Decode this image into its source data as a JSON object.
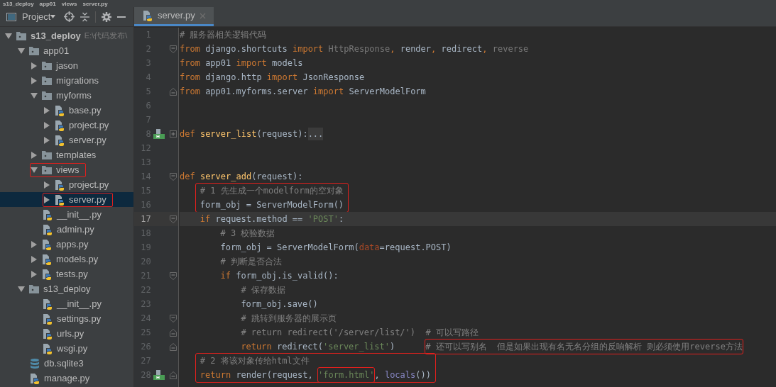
{
  "breadcrumb": [
    "s13_deploy",
    "app01",
    "views",
    "server.py"
  ],
  "project_toolbar": {
    "label": "Project"
  },
  "tree": [
    {
      "label": "s13_deploy",
      "kind": "module",
      "path": "E:\\代码发布\\",
      "expanded": true,
      "selected": false,
      "boxed": false,
      "children": [
        {
          "label": "app01",
          "kind": "module",
          "expanded": true,
          "selected": false,
          "boxed": false,
          "children": [
            {
              "label": "jason",
              "kind": "module",
              "expanded": false,
              "selected": false,
              "boxed": false
            },
            {
              "label": "migrations",
              "kind": "module",
              "expanded": false,
              "selected": false,
              "boxed": false
            },
            {
              "label": "myforms",
              "kind": "module",
              "expanded": true,
              "selected": false,
              "boxed": false,
              "children": [
                {
                  "label": "base.py",
                  "kind": "python",
                  "expanded": false,
                  "selected": false,
                  "boxed": false
                },
                {
                  "label": "project.py",
                  "kind": "python",
                  "expanded": false,
                  "selected": false,
                  "boxed": false
                },
                {
                  "label": "server.py",
                  "kind": "python",
                  "expanded": false,
                  "selected": false,
                  "boxed": false
                }
              ]
            },
            {
              "label": "templates",
              "kind": "module",
              "expanded": false,
              "selected": false,
              "boxed": false
            },
            {
              "label": "views",
              "kind": "module",
              "expanded": true,
              "selected": false,
              "boxed": true,
              "children": [
                {
                  "label": "project.py",
                  "kind": "python",
                  "expanded": false,
                  "selected": false,
                  "boxed": false
                },
                {
                  "label": "server.py",
                  "kind": "python",
                  "expanded": false,
                  "selected": true,
                  "boxed": true
                }
              ]
            },
            {
              "label": "__init__.py",
              "kind": "python",
              "selected": false,
              "boxed": false
            },
            {
              "label": "admin.py",
              "kind": "python",
              "selected": false,
              "boxed": false
            },
            {
              "label": "apps.py",
              "kind": "python",
              "expanded": false,
              "selected": false,
              "boxed": false
            },
            {
              "label": "models.py",
              "kind": "python",
              "expanded": false,
              "selected": false,
              "boxed": false
            },
            {
              "label": "tests.py",
              "kind": "python",
              "expanded": false,
              "selected": false,
              "boxed": false
            }
          ]
        },
        {
          "label": "s13_deploy",
          "kind": "module",
          "expanded": true,
          "selected": false,
          "boxed": false,
          "children": [
            {
              "label": "__init__.py",
              "kind": "python",
              "selected": false,
              "boxed": false
            },
            {
              "label": "settings.py",
              "kind": "python",
              "selected": false,
              "boxed": false
            },
            {
              "label": "urls.py",
              "kind": "python",
              "selected": false,
              "boxed": false
            },
            {
              "label": "wsgi.py",
              "kind": "python",
              "selected": false,
              "boxed": false
            }
          ]
        },
        {
          "label": "db.sqlite3",
          "kind": "database",
          "selected": false,
          "boxed": false
        },
        {
          "label": "manage.py",
          "kind": "python",
          "selected": false,
          "boxed": false
        }
      ]
    }
  ],
  "tabs": [
    {
      "label": "server.py",
      "selected": true
    }
  ],
  "code": [
    {
      "n": "1",
      "current": false,
      "boxed": false,
      "tokens": [
        {
          "t": "# 服务器相关逻辑代码",
          "kind": "comment"
        }
      ]
    },
    {
      "n": "2",
      "current": false,
      "boxed": false,
      "fold": {
        "kind": "start"
      },
      "tokens": [
        {
          "t": "from",
          "kind": "kw"
        },
        {
          "t": " django.shortcuts ",
          "kind": "plain"
        },
        {
          "t": "import ",
          "kind": "kw"
        },
        {
          "t": "HttpResponse",
          "kind": "unused"
        },
        {
          "t": ", ",
          "kind": "kw"
        },
        {
          "t": "render",
          "kind": "plain"
        },
        {
          "t": ", ",
          "kind": "kw"
        },
        {
          "t": "redirect",
          "kind": "plain"
        },
        {
          "t": ", ",
          "kind": "kw"
        },
        {
          "t": "reverse",
          "kind": "unused"
        }
      ]
    },
    {
      "n": "3",
      "current": false,
      "boxed": false,
      "tokens": [
        {
          "t": "from",
          "kind": "kw"
        },
        {
          "t": " app01 ",
          "kind": "plain"
        },
        {
          "t": "import",
          "kind": "kw"
        },
        {
          "t": " models",
          "kind": "plain"
        }
      ]
    },
    {
      "n": "4",
      "current": false,
      "boxed": false,
      "tokens": [
        {
          "t": "from",
          "kind": "kw"
        },
        {
          "t": " django.http ",
          "kind": "plain"
        },
        {
          "t": "import",
          "kind": "kw"
        },
        {
          "t": " JsonResponse",
          "kind": "plain"
        }
      ]
    },
    {
      "n": "5",
      "current": false,
      "boxed": false,
      "fold": {
        "kind": "end"
      },
      "tokens": [
        {
          "t": "from",
          "kind": "kw"
        },
        {
          "t": " app01.myforms.server ",
          "kind": "plain"
        },
        {
          "t": "import",
          "kind": "kw"
        },
        {
          "t": " ServerModelForm",
          "kind": "plain"
        }
      ]
    },
    {
      "n": "6",
      "current": false,
      "boxed": false
    },
    {
      "n": "7",
      "current": false,
      "boxed": false
    },
    {
      "n": "8",
      "current": false,
      "boxed": false,
      "fold": {
        "kind": "collapsed"
      },
      "marker": {
        "kind": "bookmark"
      },
      "tokens": [
        {
          "t": "def",
          "kind": "kw"
        },
        {
          "t": " server_list",
          "kind": "fn"
        },
        {
          "t": "(request):",
          "kind": "plain"
        },
        {
          "t": "...",
          "kind": "folded"
        }
      ]
    },
    {
      "n": "12",
      "current": false,
      "boxed": false
    },
    {
      "n": "13",
      "current": false,
      "boxed": false
    },
    {
      "n": "14",
      "current": false,
      "boxed": false,
      "fold": {
        "kind": "start"
      },
      "tokens": [
        {
          "t": "def",
          "kind": "kw"
        },
        {
          "t": " server_add",
          "kind": "fn"
        },
        {
          "t": "(request):",
          "kind": "plain"
        }
      ],
      "children": [
        {
          "n": "15",
          "current": false,
          "boxed": true,
          "tokens": [
            {
              "t": "# 1 先生成一个modelform的空对象",
              "kind": "comment"
            }
          ]
        },
        {
          "n": "16",
          "current": false,
          "boxed": true,
          "tokens": [
            {
              "t": "form_obj = ServerModelForm()",
              "kind": "plain"
            }
          ]
        },
        {
          "n": "17",
          "current": true,
          "boxed": false,
          "fold": {
            "kind": "start"
          },
          "tokens": [
            {
              "t": "if",
              "kind": "kw"
            },
            {
              "t": " request.method == ",
              "kind": "plain"
            },
            {
              "t": "'POST'",
              "kind": "str"
            },
            {
              "t": ":",
              "kind": "plain"
            }
          ],
          "children": [
            {
              "n": "18",
              "current": false,
              "boxed": false,
              "tokens": [
                {
                  "t": "# 3 校验数据",
                  "kind": "comment"
                }
              ]
            },
            {
              "n": "19",
              "current": false,
              "boxed": false,
              "tokens": [
                {
                  "t": "form_obj = ServerModelForm(",
                  "kind": "plain"
                },
                {
                  "t": "data",
                  "kind": "param"
                },
                {
                  "t": "=request.POST)",
                  "kind": "plain"
                }
              ]
            },
            {
              "n": "20",
              "current": false,
              "boxed": false,
              "tokens": [
                {
                  "t": "# 判断是否合法",
                  "kind": "comment"
                }
              ]
            },
            {
              "n": "21",
              "current": false,
              "boxed": false,
              "fold": {
                "kind": "start"
              },
              "tokens": [
                {
                  "t": "if",
                  "kind": "kw"
                },
                {
                  "t": " form_obj.is_valid():",
                  "kind": "plain"
                }
              ],
              "children": [
                {
                  "n": "22",
                  "current": false,
                  "boxed": false,
                  "tokens": [
                    {
                      "t": "# 保存数据",
                      "kind": "comment"
                    }
                  ]
                },
                {
                  "n": "23",
                  "current": false,
                  "boxed": false,
                  "tokens": [
                    {
                      "t": "form_obj.save()",
                      "kind": "plain"
                    }
                  ]
                },
                {
                  "n": "24",
                  "current": false,
                  "boxed": false,
                  "fold": {
                    "kind": "start"
                  },
                  "tokens": [
                    {
                      "t": "# 跳转到服务器的展示页",
                      "kind": "comment"
                    }
                  ]
                },
                {
                  "n": "25",
                  "current": false,
                  "boxed": false,
                  "fold": {
                    "kind": "end"
                  },
                  "tokens": [
                    {
                      "t": "# return redirect('/server/list/')  # 可以写路径",
                      "kind": "comment"
                    }
                  ]
                },
                {
                  "n": "26",
                  "current": false,
                  "boxed": false,
                  "fold": {
                    "kind": "end"
                  },
                  "tokens": [
                    {
                      "t": "return",
                      "kind": "kw"
                    },
                    {
                      "t": " redirect(",
                      "kind": "plain"
                    },
                    {
                      "t": "'server_list'",
                      "kind": "str"
                    },
                    {
                      "t": ")",
                      "kind": "plain"
                    },
                    {
                      "t": "# 还可以写别名  但是如果出现有名无名分组的反响解析 则必须使用reverse方法",
                      "kind": "comment",
                      "boxed": true
                    }
                  ]
                }
              ]
            }
          ]
        },
        {
          "n": "27",
          "current": false,
          "boxed": true,
          "tokens": [
            {
              "t": "# 2 将该对象传给html文件",
              "kind": "comment"
            }
          ]
        },
        {
          "n": "28",
          "current": false,
          "boxed": true,
          "fold": {
            "kind": "end"
          },
          "marker": {
            "kind": "bookmark"
          },
          "tokens": [
            {
              "t": "return",
              "kind": "kw"
            },
            {
              "t": " render(request, ",
              "kind": "plain"
            },
            {
              "t": "'form.html'",
              "kind": "str",
              "boxed": true
            },
            {
              "t": ", ",
              "kind": "plain"
            },
            {
              "t": "locals",
              "kind": "builtin"
            },
            {
              "t": "())",
              "kind": "plain"
            }
          ]
        }
      ]
    }
  ]
}
